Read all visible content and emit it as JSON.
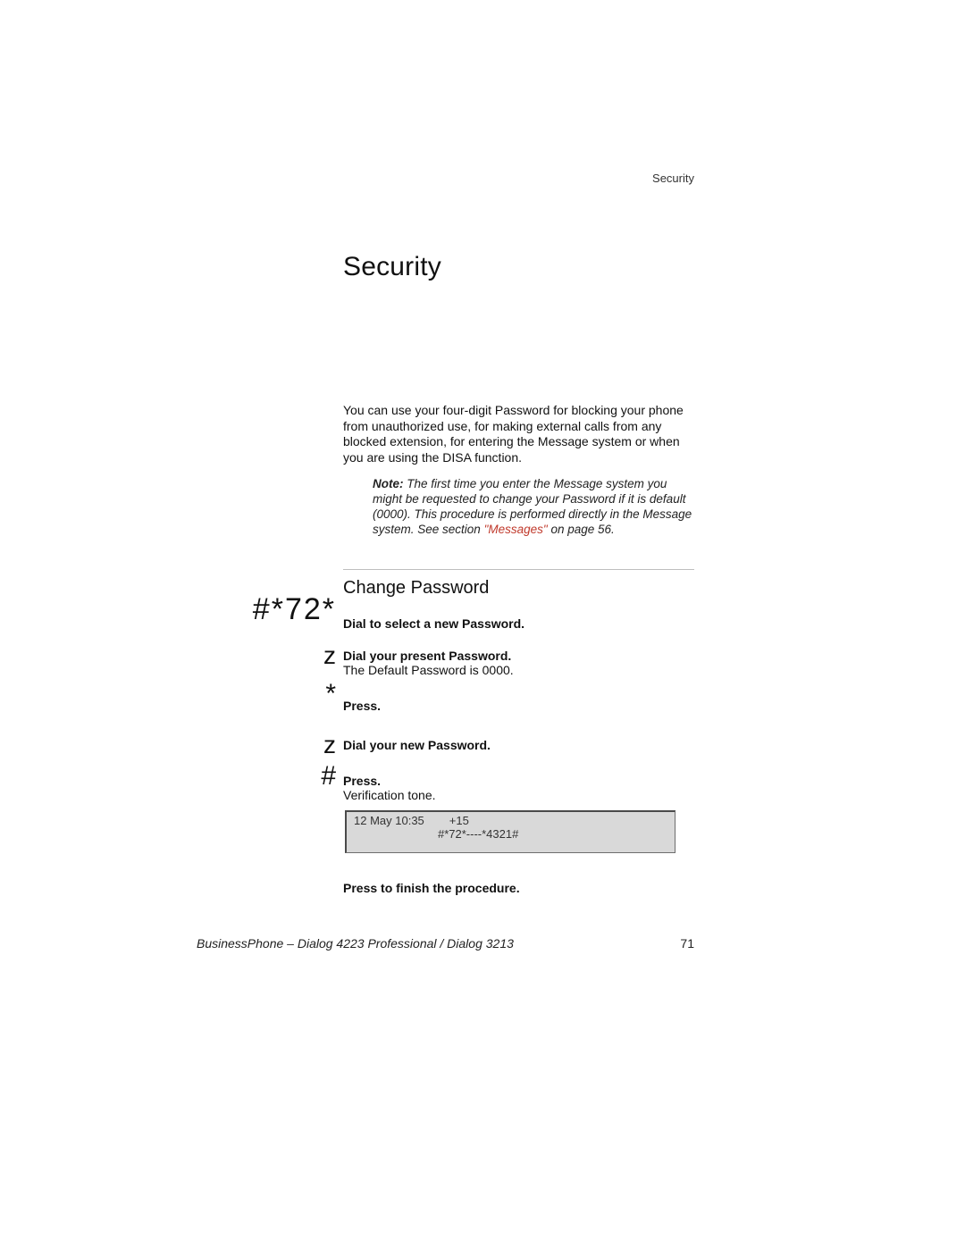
{
  "header": {
    "section_label": "Security"
  },
  "title": "Security",
  "intro": "You can use your four-digit Password for blocking your phone from unauthorized use, for making external calls from any blocked extension, for entering the Message system or when you are using the DISA function.",
  "note": {
    "label": "Note:",
    "body_before_link": " The first time you enter the Message system you might be requested to change your Password if it is default (0000). This procedure is performed directly in the Message system. See section ",
    "link_text": "\"Messages\"",
    "body_after_link": " on page 56."
  },
  "subheading": "Change Password",
  "steps": {
    "s1": {
      "key": "#*72*",
      "desc": "Dial to select a new Password."
    },
    "s2": {
      "key": "z",
      "desc": "Dial your present Password.",
      "sub": "The Default Password is 0000."
    },
    "s3": {
      "key": "*",
      "desc": "Press."
    },
    "s4": {
      "key": "z",
      "desc": "Dial your new Password."
    },
    "s5": {
      "key": "#",
      "desc": "Press.",
      "sub": "Verification tone."
    },
    "s6": {
      "desc": "Press to finish the procedure."
    }
  },
  "lcd": {
    "date": "12 May 10:35",
    "ext": "+15",
    "code": "#*72*----*4321#"
  },
  "footer": {
    "doc": "BusinessPhone – Dialog 4223 Professional / Dialog 3213",
    "page": "71"
  }
}
